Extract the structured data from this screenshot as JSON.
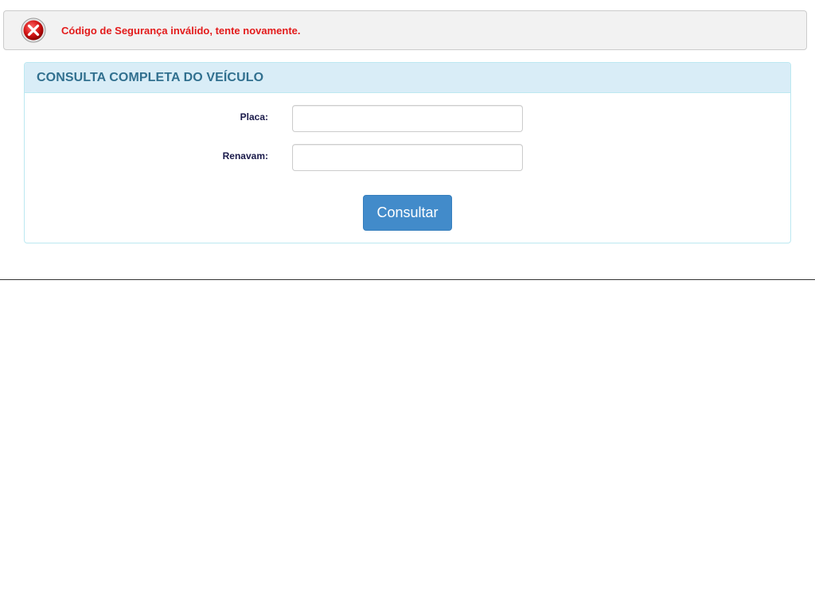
{
  "alert": {
    "message": "Código de Segurança inválido, tente novamente.",
    "icon": "error-circle-x-icon",
    "text_color": "#e31b1b"
  },
  "panel": {
    "title": "CONSULTA COMPLETA DO VEÍCULO",
    "fields": {
      "placa": {
        "label": "Placa:",
        "value": ""
      },
      "renavam": {
        "label": "Renavam:",
        "value": ""
      }
    },
    "submit_label": "Consultar"
  },
  "colors": {
    "panel_heading_bg": "#d9edf7",
    "panel_title": "#31708f",
    "button": "#428bca"
  }
}
